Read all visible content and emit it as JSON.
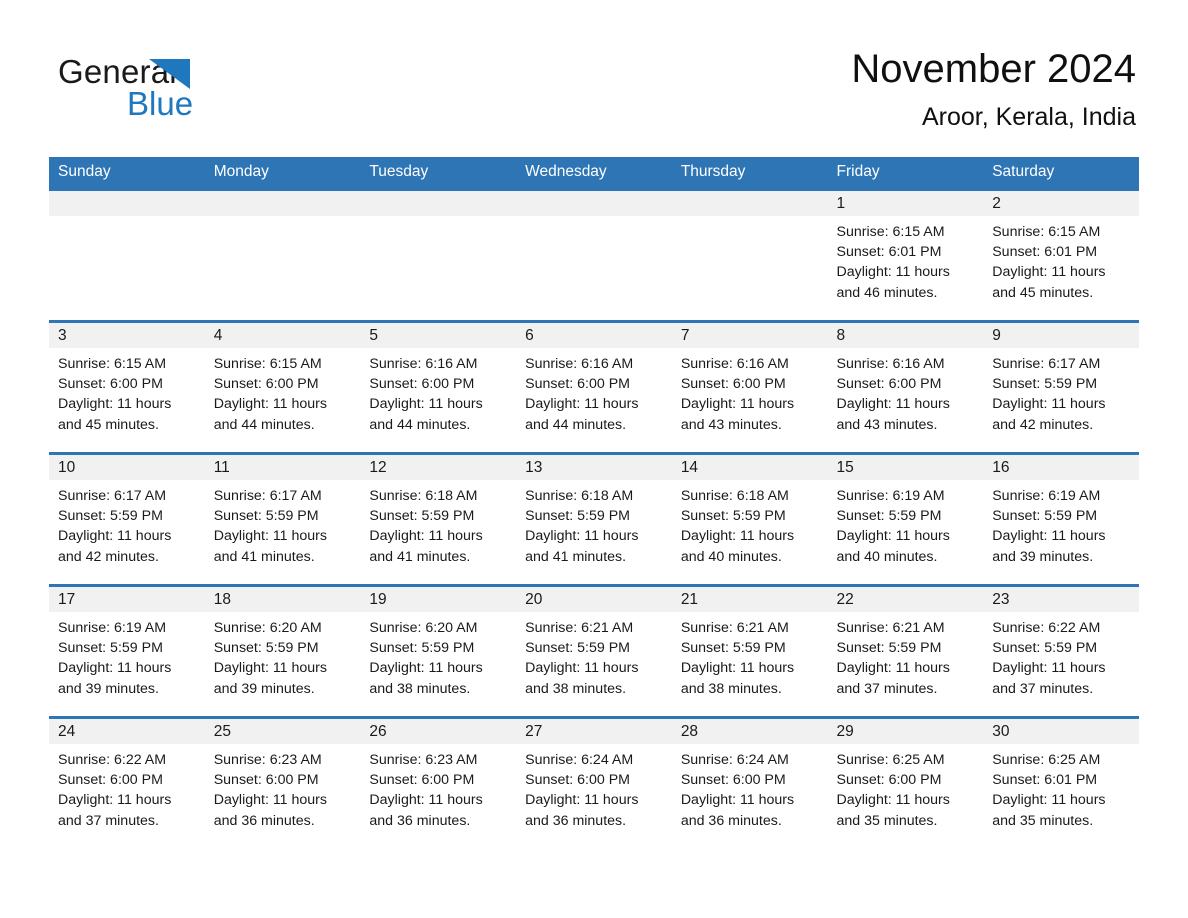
{
  "logo": {
    "word_one": "General",
    "word_two": "Blue",
    "triangle_icon": "triangle-icon",
    "accent_color": "#1f77bd"
  },
  "header": {
    "title": "November 2024",
    "subtitle": "Aroor, Kerala, India"
  },
  "colors": {
    "header_blue": "#2e75b6",
    "daynum_band": "#f1f1f1",
    "text": "#1a1a1a"
  },
  "weekdays": [
    "Sunday",
    "Monday",
    "Tuesday",
    "Wednesday",
    "Thursday",
    "Friday",
    "Saturday"
  ],
  "labels": {
    "sunrise_prefix": "Sunrise: ",
    "sunset_prefix": "Sunset: ",
    "daylight_prefix": "Daylight: "
  },
  "weeks": [
    [
      {
        "day": "",
        "sunrise": "",
        "sunset": "",
        "daylight_line1": "",
        "daylight_line2": ""
      },
      {
        "day": "",
        "sunrise": "",
        "sunset": "",
        "daylight_line1": "",
        "daylight_line2": ""
      },
      {
        "day": "",
        "sunrise": "",
        "sunset": "",
        "daylight_line1": "",
        "daylight_line2": ""
      },
      {
        "day": "",
        "sunrise": "",
        "sunset": "",
        "daylight_line1": "",
        "daylight_line2": ""
      },
      {
        "day": "",
        "sunrise": "",
        "sunset": "",
        "daylight_line1": "",
        "daylight_line2": ""
      },
      {
        "day": "1",
        "sunrise": "Sunrise: 6:15 AM",
        "sunset": "Sunset: 6:01 PM",
        "daylight_line1": "Daylight: 11 hours",
        "daylight_line2": "and 46 minutes."
      },
      {
        "day": "2",
        "sunrise": "Sunrise: 6:15 AM",
        "sunset": "Sunset: 6:01 PM",
        "daylight_line1": "Daylight: 11 hours",
        "daylight_line2": "and 45 minutes."
      }
    ],
    [
      {
        "day": "3",
        "sunrise": "Sunrise: 6:15 AM",
        "sunset": "Sunset: 6:00 PM",
        "daylight_line1": "Daylight: 11 hours",
        "daylight_line2": "and 45 minutes."
      },
      {
        "day": "4",
        "sunrise": "Sunrise: 6:15 AM",
        "sunset": "Sunset: 6:00 PM",
        "daylight_line1": "Daylight: 11 hours",
        "daylight_line2": "and 44 minutes."
      },
      {
        "day": "5",
        "sunrise": "Sunrise: 6:16 AM",
        "sunset": "Sunset: 6:00 PM",
        "daylight_line1": "Daylight: 11 hours",
        "daylight_line2": "and 44 minutes."
      },
      {
        "day": "6",
        "sunrise": "Sunrise: 6:16 AM",
        "sunset": "Sunset: 6:00 PM",
        "daylight_line1": "Daylight: 11 hours",
        "daylight_line2": "and 44 minutes."
      },
      {
        "day": "7",
        "sunrise": "Sunrise: 6:16 AM",
        "sunset": "Sunset: 6:00 PM",
        "daylight_line1": "Daylight: 11 hours",
        "daylight_line2": "and 43 minutes."
      },
      {
        "day": "8",
        "sunrise": "Sunrise: 6:16 AM",
        "sunset": "Sunset: 6:00 PM",
        "daylight_line1": "Daylight: 11 hours",
        "daylight_line2": "and 43 minutes."
      },
      {
        "day": "9",
        "sunrise": "Sunrise: 6:17 AM",
        "sunset": "Sunset: 5:59 PM",
        "daylight_line1": "Daylight: 11 hours",
        "daylight_line2": "and 42 minutes."
      }
    ],
    [
      {
        "day": "10",
        "sunrise": "Sunrise: 6:17 AM",
        "sunset": "Sunset: 5:59 PM",
        "daylight_line1": "Daylight: 11 hours",
        "daylight_line2": "and 42 minutes."
      },
      {
        "day": "11",
        "sunrise": "Sunrise: 6:17 AM",
        "sunset": "Sunset: 5:59 PM",
        "daylight_line1": "Daylight: 11 hours",
        "daylight_line2": "and 41 minutes."
      },
      {
        "day": "12",
        "sunrise": "Sunrise: 6:18 AM",
        "sunset": "Sunset: 5:59 PM",
        "daylight_line1": "Daylight: 11 hours",
        "daylight_line2": "and 41 minutes."
      },
      {
        "day": "13",
        "sunrise": "Sunrise: 6:18 AM",
        "sunset": "Sunset: 5:59 PM",
        "daylight_line1": "Daylight: 11 hours",
        "daylight_line2": "and 41 minutes."
      },
      {
        "day": "14",
        "sunrise": "Sunrise: 6:18 AM",
        "sunset": "Sunset: 5:59 PM",
        "daylight_line1": "Daylight: 11 hours",
        "daylight_line2": "and 40 minutes."
      },
      {
        "day": "15",
        "sunrise": "Sunrise: 6:19 AM",
        "sunset": "Sunset: 5:59 PM",
        "daylight_line1": "Daylight: 11 hours",
        "daylight_line2": "and 40 minutes."
      },
      {
        "day": "16",
        "sunrise": "Sunrise: 6:19 AM",
        "sunset": "Sunset: 5:59 PM",
        "daylight_line1": "Daylight: 11 hours",
        "daylight_line2": "and 39 minutes."
      }
    ],
    [
      {
        "day": "17",
        "sunrise": "Sunrise: 6:19 AM",
        "sunset": "Sunset: 5:59 PM",
        "daylight_line1": "Daylight: 11 hours",
        "daylight_line2": "and 39 minutes."
      },
      {
        "day": "18",
        "sunrise": "Sunrise: 6:20 AM",
        "sunset": "Sunset: 5:59 PM",
        "daylight_line1": "Daylight: 11 hours",
        "daylight_line2": "and 39 minutes."
      },
      {
        "day": "19",
        "sunrise": "Sunrise: 6:20 AM",
        "sunset": "Sunset: 5:59 PM",
        "daylight_line1": "Daylight: 11 hours",
        "daylight_line2": "and 38 minutes."
      },
      {
        "day": "20",
        "sunrise": "Sunrise: 6:21 AM",
        "sunset": "Sunset: 5:59 PM",
        "daylight_line1": "Daylight: 11 hours",
        "daylight_line2": "and 38 minutes."
      },
      {
        "day": "21",
        "sunrise": "Sunrise: 6:21 AM",
        "sunset": "Sunset: 5:59 PM",
        "daylight_line1": "Daylight: 11 hours",
        "daylight_line2": "and 38 minutes."
      },
      {
        "day": "22",
        "sunrise": "Sunrise: 6:21 AM",
        "sunset": "Sunset: 5:59 PM",
        "daylight_line1": "Daylight: 11 hours",
        "daylight_line2": "and 37 minutes."
      },
      {
        "day": "23",
        "sunrise": "Sunrise: 6:22 AM",
        "sunset": "Sunset: 5:59 PM",
        "daylight_line1": "Daylight: 11 hours",
        "daylight_line2": "and 37 minutes."
      }
    ],
    [
      {
        "day": "24",
        "sunrise": "Sunrise: 6:22 AM",
        "sunset": "Sunset: 6:00 PM",
        "daylight_line1": "Daylight: 11 hours",
        "daylight_line2": "and 37 minutes."
      },
      {
        "day": "25",
        "sunrise": "Sunrise: 6:23 AM",
        "sunset": "Sunset: 6:00 PM",
        "daylight_line1": "Daylight: 11 hours",
        "daylight_line2": "and 36 minutes."
      },
      {
        "day": "26",
        "sunrise": "Sunrise: 6:23 AM",
        "sunset": "Sunset: 6:00 PM",
        "daylight_line1": "Daylight: 11 hours",
        "daylight_line2": "and 36 minutes."
      },
      {
        "day": "27",
        "sunrise": "Sunrise: 6:24 AM",
        "sunset": "Sunset: 6:00 PM",
        "daylight_line1": "Daylight: 11 hours",
        "daylight_line2": "and 36 minutes."
      },
      {
        "day": "28",
        "sunrise": "Sunrise: 6:24 AM",
        "sunset": "Sunset: 6:00 PM",
        "daylight_line1": "Daylight: 11 hours",
        "daylight_line2": "and 36 minutes."
      },
      {
        "day": "29",
        "sunrise": "Sunrise: 6:25 AM",
        "sunset": "Sunset: 6:00 PM",
        "daylight_line1": "Daylight: 11 hours",
        "daylight_line2": "and 35 minutes."
      },
      {
        "day": "30",
        "sunrise": "Sunrise: 6:25 AM",
        "sunset": "Sunset: 6:01 PM",
        "daylight_line1": "Daylight: 11 hours",
        "daylight_line2": "and 35 minutes."
      }
    ]
  ]
}
